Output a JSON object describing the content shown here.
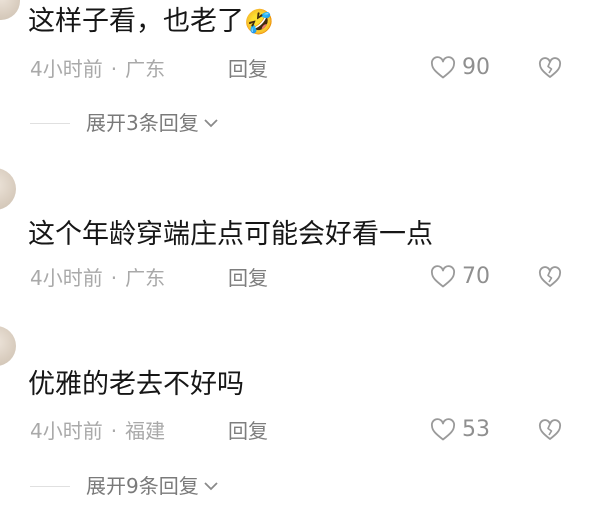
{
  "comments": [
    {
      "nickname": "",
      "text": "这样子看，也老了",
      "emoji": "🤣",
      "time": "4小时前",
      "separator": "·",
      "location": "广东",
      "reply_label": "回复",
      "likes": "90",
      "expand_label": "展开3条回复"
    },
    {
      "nickname": "",
      "text": "这个年龄穿端庄点可能会好看一点",
      "time": "4小时前",
      "separator": "·",
      "location": "广东",
      "reply_label": "回复",
      "likes": "70"
    },
    {
      "nickname": "",
      "text": "优雅的老去不好吗",
      "time": "4小时前",
      "separator": "·",
      "location": "福建",
      "reply_label": "回复",
      "likes": "53",
      "expand_label": "展开9条回复"
    }
  ],
  "icons": {
    "like": "heart-outline-icon",
    "dislike": "broken-heart-icon",
    "expand": "chevron-down-icon"
  },
  "colors": {
    "text": "#161616",
    "meta": "#a9a9a9",
    "action": "#8f8f8f"
  }
}
